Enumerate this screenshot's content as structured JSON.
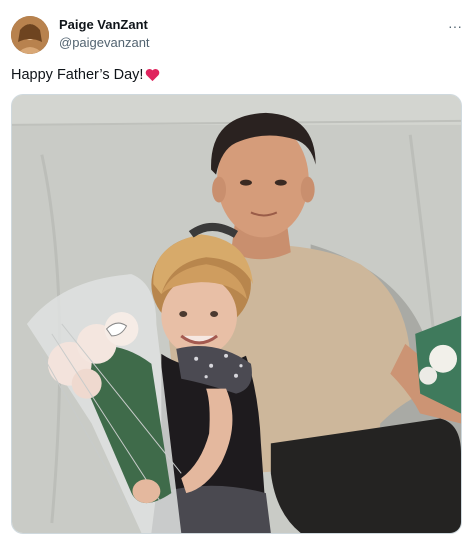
{
  "author": {
    "display_name": "Paige VanZant",
    "handle": "@paigevanzant",
    "avatar_icon": "profile-avatar"
  },
  "tweet": {
    "text": "Happy Father’s Day!",
    "emoji_icon": "red-heart-icon",
    "accent_color": "#e0245e"
  },
  "actions": {
    "more_label": "···",
    "more_icon": "more-options-icon"
  },
  "media": {
    "type": "photo",
    "description_icon": "tweet-photo"
  }
}
